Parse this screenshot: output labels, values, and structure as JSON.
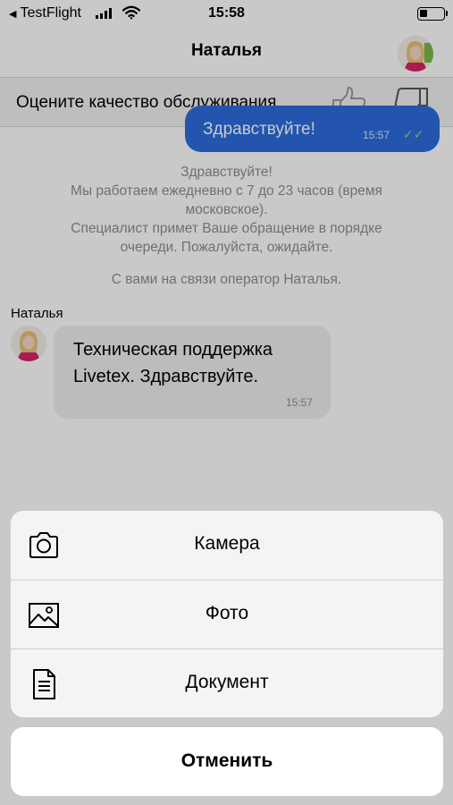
{
  "status_bar": {
    "back_app": "TestFlight",
    "time": "15:58"
  },
  "nav": {
    "title": "Наталья",
    "avatar_icon": "operator-avatar"
  },
  "rating": {
    "text": "Оцените качество обслуживания",
    "like_icon": "thumbs-up-icon",
    "dislike_icon": "thumbs-down-icon"
  },
  "chat": {
    "outgoing": {
      "text": "Здравствуйте!",
      "time": "15:57",
      "status_icon": "double-check-icon"
    },
    "system_greeting_lines": [
      "Здравствуйте!",
      "Мы работаем ежедневно с 7 до 23 часов (время",
      "московское).",
      "Специалист примет Ваше обращение в порядке",
      "очереди. Пожалуйста, ожидайте."
    ],
    "system_operator": "С вами на связи оператор Наталья.",
    "incoming": {
      "sender": "Наталья",
      "lines": [
        "Техническая поддержка",
        "Livetex. Здравствуйте."
      ],
      "time": "15:57"
    }
  },
  "action_sheet": {
    "items": [
      {
        "label": "Камера",
        "icon": "camera-icon"
      },
      {
        "label": "Фото",
        "icon": "photo-icon"
      },
      {
        "label": "Документ",
        "icon": "document-icon"
      }
    ],
    "cancel_label": "Отменить"
  },
  "colors": {
    "outgoing_bubble": "#2d6cdf",
    "incoming_bubble": "#efefef",
    "system_text": "#8e8e93",
    "sheet_bg": "#f4f4f4",
    "dim_overlay": "rgba(0,0,0,0.21)"
  }
}
